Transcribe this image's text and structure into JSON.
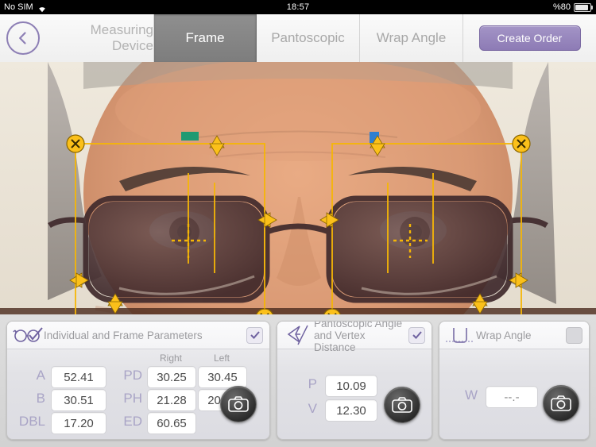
{
  "statusbar": {
    "carrier": "No SIM",
    "time": "18:57",
    "battery": "%80",
    "wifi_icon": "wifi-icon",
    "battery_icon": "battery-icon"
  },
  "tabs": {
    "back_icon": "back-chevron-icon",
    "items": [
      {
        "label": "Measuring Device",
        "selected": false
      },
      {
        "label": "Frame",
        "selected": true
      },
      {
        "label": "Pantoscopic",
        "selected": false
      },
      {
        "label": "Wrap Angle",
        "selected": false
      }
    ],
    "create_order": "Create Order"
  },
  "overlay": {
    "accent_color": "#f5b606",
    "handle_fill": "#fbc01a",
    "marker_left_color": "#1f9a72",
    "marker_right_color": "#2f7fd0"
  },
  "cards": [
    {
      "id": "individual-frame-parameters",
      "title": "Individual and Frame Parameters",
      "icon": "glasses-check-icon",
      "checked": true,
      "column_headers": [
        "Right",
        "Left"
      ],
      "fields": [
        {
          "label": "A",
          "value": "52.41"
        },
        {
          "label": "B",
          "value": "30.51"
        },
        {
          "label": "DBL",
          "value": "17.20"
        },
        {
          "label": "PD",
          "right": "30.25",
          "left": "30.45"
        },
        {
          "label": "PH",
          "right": "21.28",
          "left": "20.56"
        },
        {
          "label": "ED",
          "right": "60.65",
          "left": ""
        }
      ],
      "camera": "camera-button"
    },
    {
      "id": "pantoscopic-angle-vertex-distance",
      "title": "Pantoscopic Angle and Vertex Distance",
      "icon": "pantoscopic-angle-icon",
      "checked": true,
      "fields": [
        {
          "label": "P",
          "value": "10.09"
        },
        {
          "label": "V",
          "value": "12.30"
        }
      ],
      "camera": "camera-button"
    },
    {
      "id": "wrap-angle",
      "title": "Wrap Angle",
      "icon": "wrap-angle-icon",
      "checked": false,
      "fields": [
        {
          "label": "W",
          "value": "--.-"
        }
      ],
      "camera": "camera-button"
    }
  ]
}
